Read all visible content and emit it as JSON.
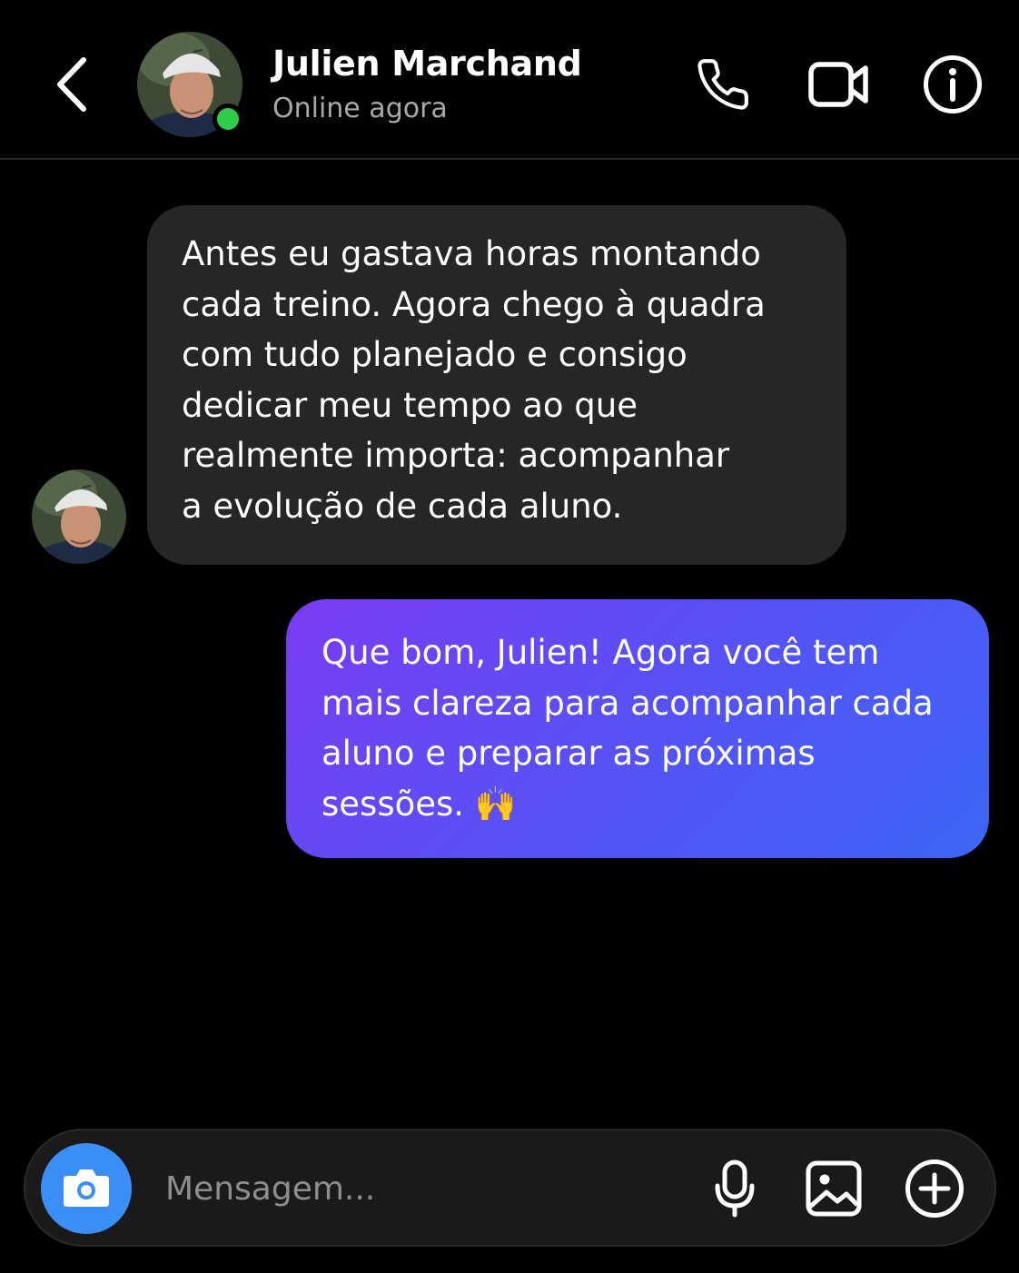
{
  "header": {
    "name": "Julien Marchand",
    "status": "Online agora"
  },
  "messages": [
    {
      "direction": "incoming",
      "text": "Antes eu gastava horas montando\ncada treino. Agora chego à quadra\ncom tudo planejado e consigo\ndedicar meu tempo ao que\nrealmente importa: acompanhar\na evolução de cada aluno."
    },
    {
      "direction": "outgoing",
      "text": "Que bom, Julien! Agora você tem\nmais clareza para acompanhar cada\naluno e preparar as próximas\nsessões. 🙌"
    }
  ],
  "composer": {
    "placeholder": "Mensagem..."
  },
  "icons": {
    "back": "chevron-left-icon",
    "call": "phone-icon",
    "video": "video-camera-icon",
    "info": "info-icon",
    "camera": "camera-icon",
    "mic": "microphone-icon",
    "gallery": "image-icon",
    "add": "plus-circle-icon"
  },
  "colors": {
    "background": "#000000",
    "incoming_bubble": "#262626",
    "outgoing_gradient_start": "#7a3cf3",
    "outgoing_gradient_end": "#3c66f6",
    "online_dot": "#2ecc4a",
    "camera_button": "#3a8ef6",
    "status_text": "#a8a8a8"
  }
}
